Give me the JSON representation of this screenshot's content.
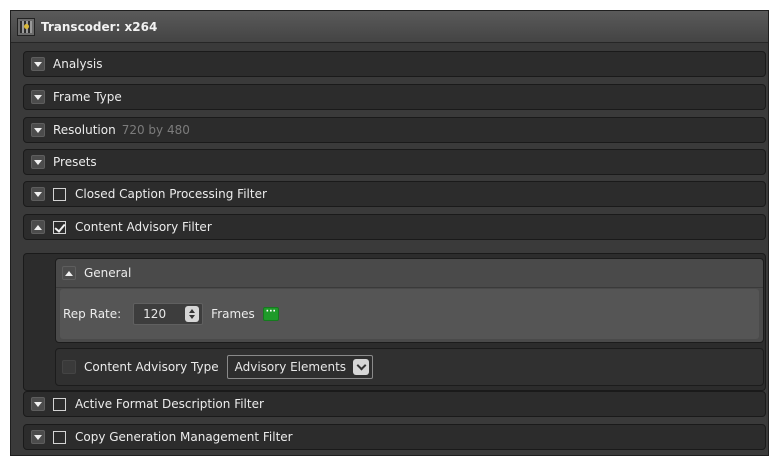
{
  "window": {
    "title": "Transcoder: x264"
  },
  "sections": {
    "analysis": {
      "label": "Analysis"
    },
    "frame_type": {
      "label": "Frame Type"
    },
    "resolution": {
      "label": "Resolution",
      "value": "720 by 480"
    },
    "presets": {
      "label": "Presets"
    },
    "closed_caption": {
      "label": "Closed Caption Processing Filter",
      "checked": false
    },
    "content_advisory": {
      "label": "Content Advisory Filter",
      "checked": true
    },
    "active_format": {
      "label": "Active Format Description Filter",
      "checked": false
    },
    "copy_generation": {
      "label": "Copy Generation Management Filter",
      "checked": false
    }
  },
  "content_advisory": {
    "general": {
      "label": "General",
      "rep_rate_label": "Rep Rate:",
      "rep_rate_value": "120",
      "frames_label": "Frames",
      "more_button": "···"
    },
    "type": {
      "label": "Content Advisory Type",
      "selected": "Advisory Elements"
    }
  },
  "colors": {
    "panel_bg": "#3a3a3a",
    "row_bg": "#2c2c2c",
    "accent_green": "#1f9a2a",
    "dim_text": "#7c7c7c"
  }
}
